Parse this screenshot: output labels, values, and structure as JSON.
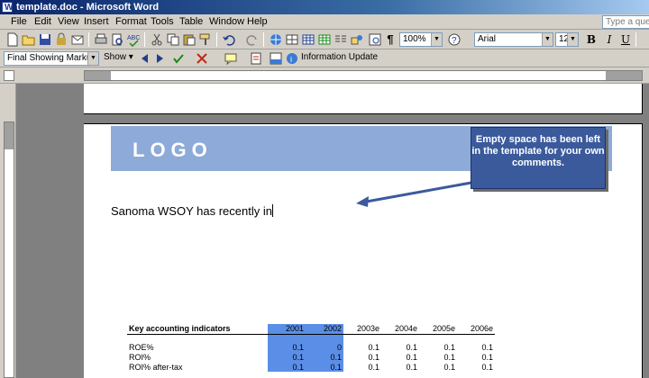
{
  "window": {
    "title": "template.doc - Microsoft Word"
  },
  "menu": [
    "File",
    "Edit",
    "View",
    "Insert",
    "Format",
    "Tools",
    "Table",
    "Window",
    "Help"
  ],
  "help_box": {
    "placeholder": "Type a question"
  },
  "formatting": {
    "zoom": "100%",
    "font": "Arial",
    "size": "12",
    "bold": "B",
    "italic": "I",
    "underline": "U"
  },
  "reviewing": {
    "markup": "Final Showing Markup",
    "show": "Show",
    "info_update": "Information Update"
  },
  "page": {
    "logo": "LOGO",
    "callout": "Empty space has been left in the template for your own comments.",
    "body_text": "Sanoma WSOY has recently in"
  },
  "table": {
    "title": "Key accounting indicators",
    "columns": [
      "2001",
      "2002",
      "2003e",
      "2004e",
      "2005e",
      "2006e"
    ],
    "rows": [
      {
        "label": "ROE%",
        "values": [
          "0.1",
          "0",
          "0.1",
          "0.1",
          "0.1",
          "0.1"
        ]
      },
      {
        "label": "ROI%",
        "values": [
          "0.1",
          "0.1",
          "0.1",
          "0.1",
          "0.1",
          "0.1"
        ]
      },
      {
        "label": "ROI% after-tax",
        "values": [
          "0.1",
          "0.1",
          "0.1",
          "0.1",
          "0.1",
          "0.1"
        ]
      }
    ],
    "highlight_color": "#5b8ee6"
  },
  "colors": {
    "logo_band": "#8eaad8",
    "callout": "#3b5a9c"
  }
}
